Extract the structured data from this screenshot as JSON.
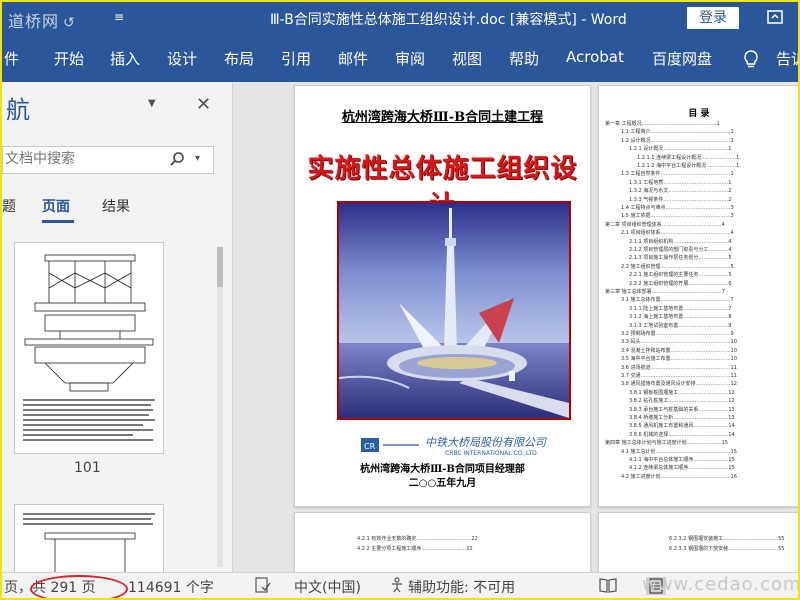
{
  "window": {
    "watermark": "道桥网",
    "doc_title": "Ⅲ-B合同实施性总体施工组织设计.doc [兼容模式] - Word",
    "login_label": "登录"
  },
  "ribbon": {
    "tabs": [
      "件",
      "开始",
      "插入",
      "设计",
      "布局",
      "引用",
      "邮件",
      "审阅",
      "视图",
      "帮助",
      "Acrobat",
      "百度网盘",
      "告诉"
    ]
  },
  "nav": {
    "title": "航",
    "search_placeholder": "文档中搜索",
    "tabs": [
      "题",
      "页面",
      "结果"
    ],
    "active_tab": "页面",
    "thumb_page_number": "101"
  },
  "cover": {
    "heading": "杭州湾跨海大桥Ⅲ-B合同土建工程",
    "title": "实施性总体施工组织设计",
    "company": "中铁大桥局股份有限公司",
    "company_en": "CRBC INTERNATIONAL CO.,LTD",
    "project_dept": "杭州湾跨海大桥Ⅲ-B合同项目经理部",
    "date": "二○○五年九月"
  },
  "toc": {
    "title": "目  录",
    "lines": [
      "第一章 工程概况………………………………………1",
      "1.1 工程简介…………………………………………1",
      "1.2 设计概况…………………………………………1",
      "1.2.1 设计概况…………………………………1",
      "1.2.1.1 连续梁工程设计概况…………………1",
      "1.2.1.2 海中平台工程设计概况………………1",
      "1.3 工程自然条件……………………………………1",
      "1.3.1 工程地质…………………………………1",
      "1.3.2 海况与水文………………………………2",
      "1.3.3 气候条件…………………………………2",
      "1.4 工程特点与难点…………………………………3",
      "1.5 施工依据…………………………………………3",
      "第二章 项目组织管理体系………………………………4",
      "2.1 项目组织体系……………………………………4",
      "2.1.1 项目组织机构……………………………4",
      "2.1.2 项目管理层的部门职责与分工…………4",
      "2.1.3 项目施工操作层任务划分………………5",
      "2.2 施工组织管理……………………………………5",
      "2.2.1 施工组织管理的主要任务………………5",
      "2.2.2 施工组织管理的开展……………………6",
      "第三章 施工总体部署……………………………………7",
      "3.1 施工总体布置……………………………………7",
      "3.1.1 陆上施工基地布置………………………7",
      "3.1.2 海上施工基地布置………………………8",
      "3.1.3 工地试验室布置…………………………9",
      "3.2 预制场布置………………………………………9",
      "3.3 码头………………………………………………10",
      "3.4 混凝土拌和站布置………………………………10",
      "3.5 海中平台施工布置………………………………10",
      "3.6 进场航道…………………………………………11",
      "3.7 交通………………………………………………11",
      "3.8 通风措施布置及通风设计安排…………………12",
      "3.8.1 钢板桩围堰施工…………………………12",
      "3.8.2 钻孔桩施工………………………………12",
      "3.8.3 承台施工与桩基础的关系………………13",
      "3.8.4 桥墩施工分析……………………………13",
      "3.8.5 通风机施工布置和通风…………………14",
      "3.8.6 机械的选择………………………………14",
      "第四章 施工总体计划与施工进度计划…………………15",
      "4.1 施工总计划………………………………………15",
      "4.1.1 海中平台总体施工顺序…………………15",
      "4.1.2 连续梁总体施工顺序……………………15",
      "4.2 施工进度计划……………………………………16"
    ]
  },
  "lower_pages": {
    "left_lines": [
      "4.2.1 有效作业天数的确定……………………………22",
      "4.2.2 主要分项工程施工顺序………………………22"
    ],
    "right_lines": [
      "6.2.3.2 钢围堰安装施工……………………………55",
      "6.2.3.3 钢围堰的下放安装…………………………55"
    ]
  },
  "status": {
    "page_info": "页，共 291 页",
    "word_count": "114691 个字",
    "language": "中文(中国)",
    "accessibility": "辅助功能: 不可用",
    "watermark": "www.cedao.com"
  },
  "colors": {
    "word_blue": "#2b579a",
    "title_red": "#d61818",
    "highlight_oval": "#d92525",
    "frame_yellow": "#f1e400"
  }
}
